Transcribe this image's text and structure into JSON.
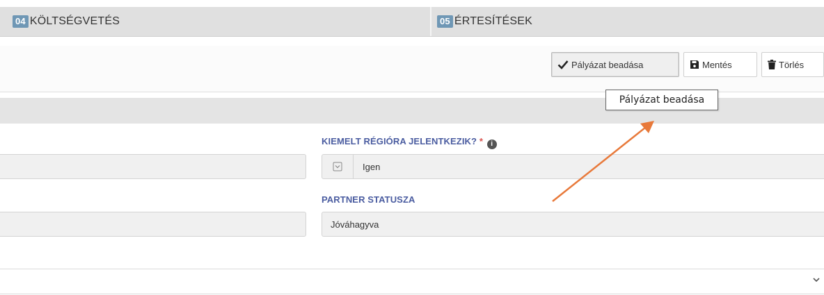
{
  "tabs": [
    {
      "number": "04",
      "label": "KÖLTSÉGVETÉS"
    },
    {
      "number": "05",
      "label": "ÉRTESÍTÉSEK"
    }
  ],
  "toolbar": {
    "submit_label": "Pályázat beadása",
    "save_label": "Mentés",
    "delete_label": "Törlés"
  },
  "tooltip": {
    "text": "Pályázat beadása"
  },
  "form": {
    "kiemelt": {
      "label": "KIEMELT RÉGIÓRA JELENTKEZIK?",
      "required_mark": "*",
      "value": "Igen"
    },
    "partner": {
      "label": "PARTNER STATUSZA",
      "value": "Jóváhagyva"
    }
  },
  "colors": {
    "tab_badge": "#6f97b5",
    "label_text": "#4a5ca0",
    "required": "#d9534f",
    "annotation_arrow": "#e8793a"
  },
  "icons": {
    "submit": "check-icon",
    "save": "floppy-disk-icon",
    "delete": "trash-icon",
    "info": "info-circle-icon",
    "select": "dropdown-square-icon",
    "expand": "chevron-down-icon"
  }
}
